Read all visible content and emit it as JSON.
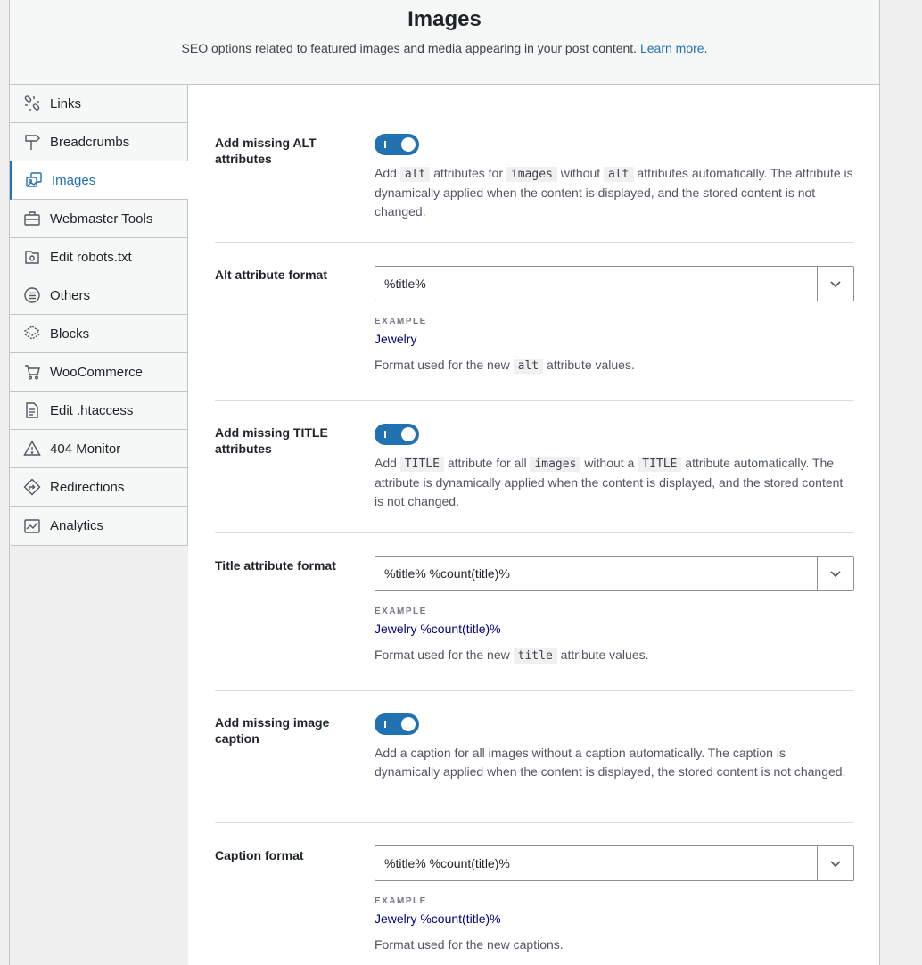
{
  "header": {
    "title": "Images",
    "description": "SEO options related to featured images and media appearing in your post content.",
    "learn_more": "Learn more"
  },
  "sidebar": {
    "items": [
      {
        "label": "Links",
        "icon": "links-icon"
      },
      {
        "label": "Breadcrumbs",
        "icon": "signpost-icon"
      },
      {
        "label": "Images",
        "icon": "images-icon",
        "active": true
      },
      {
        "label": "Webmaster Tools",
        "icon": "toolbox-icon"
      },
      {
        "label": "Edit robots.txt",
        "icon": "robots-file-icon"
      },
      {
        "label": "Others",
        "icon": "list-circle-icon"
      },
      {
        "label": "Blocks",
        "icon": "blocks-icon"
      },
      {
        "label": "WooCommerce",
        "icon": "cart-icon"
      },
      {
        "label": "Edit .htaccess",
        "icon": "htaccess-file-icon"
      },
      {
        "label": "404 Monitor",
        "icon": "warning-icon"
      },
      {
        "label": "Redirections",
        "icon": "redirect-icon"
      },
      {
        "label": "Analytics",
        "icon": "analytics-icon"
      }
    ]
  },
  "settings": {
    "alt_toggle": {
      "label": "Add missing ALT attributes",
      "enabled": true,
      "desc_1": "Add",
      "code_1": "alt",
      "desc_2": "attributes for",
      "code_2": "images",
      "desc_3": "without",
      "code_3": "alt",
      "desc_4": "attributes automatically. The attribute is dynamically applied when the content is displayed, and the stored content is not changed."
    },
    "alt_format": {
      "label": "Alt attribute format",
      "value": "%title%",
      "example_label": "EXAMPLE",
      "example": "Jewelry",
      "desc_1": "Format used for the new",
      "code_1": "alt",
      "desc_2": "attribute values."
    },
    "title_toggle": {
      "label": "Add missing TITLE attributes",
      "enabled": true,
      "desc_1": "Add",
      "code_1": "TITLE",
      "desc_2": "attribute for all",
      "code_2": "images",
      "desc_3": "without a",
      "code_3": "TITLE",
      "desc_4": "attribute automatically. The attribute is dynamically applied when the content is displayed, and the stored content is not changed."
    },
    "title_format": {
      "label": "Title attribute format",
      "value": "%title% %count(title)%",
      "example_label": "EXAMPLE",
      "example": "Jewelry %count(title)%",
      "desc_1": "Format used for the new",
      "code_1": "title",
      "desc_2": "attribute values."
    },
    "caption_toggle": {
      "label": "Add missing image caption",
      "enabled": true,
      "desc": "Add a caption for all images without a caption automatically. The caption is dynamically applied when the content is displayed, the stored content is not changed."
    },
    "caption_format": {
      "label": "Caption format",
      "value": "%title% %count(title)%",
      "example_label": "EXAMPLE",
      "example": "Jewelry %count(title)%",
      "desc": "Format used for the new captions."
    }
  },
  "colors": {
    "accent": "#2271b1",
    "example_text": "#000080"
  }
}
